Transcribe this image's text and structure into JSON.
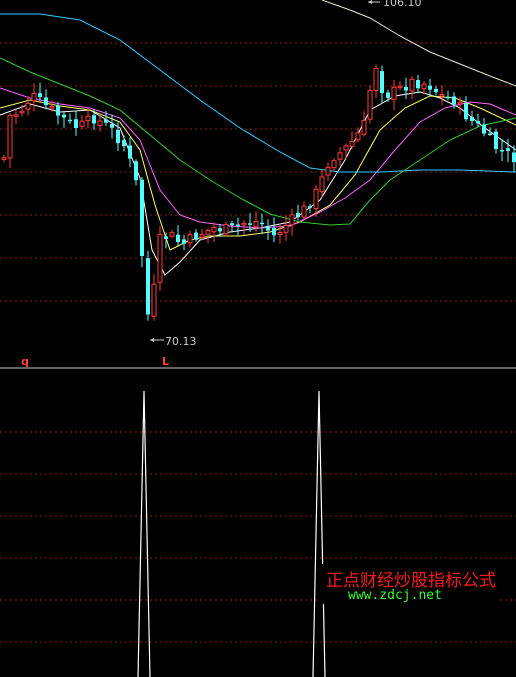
{
  "price_panel": {
    "high_label": "106.10",
    "low_label": "70.13",
    "marker_q": "q",
    "marker_l": "L"
  },
  "indicator_panel": {
    "signal_spikes": 2
  },
  "watermark": {
    "title": "正点财经炒股指标公式",
    "url": "www.zdcj.net"
  },
  "colors": {
    "background": "#000000",
    "up_candle": "#ff3b3b",
    "down_candle": "#54ffff",
    "grid": "#8b1a1a",
    "ma_white": "#ffffff",
    "ma_yellow": "#ffff66",
    "ma_magenta": "#ff66ff",
    "ma_green": "#33cc33",
    "ma_cyan": "#33ccff",
    "ma_long": "#e6e6cc",
    "watermark_title": "#ff1a1a",
    "watermark_url": "#33ff33"
  }
}
